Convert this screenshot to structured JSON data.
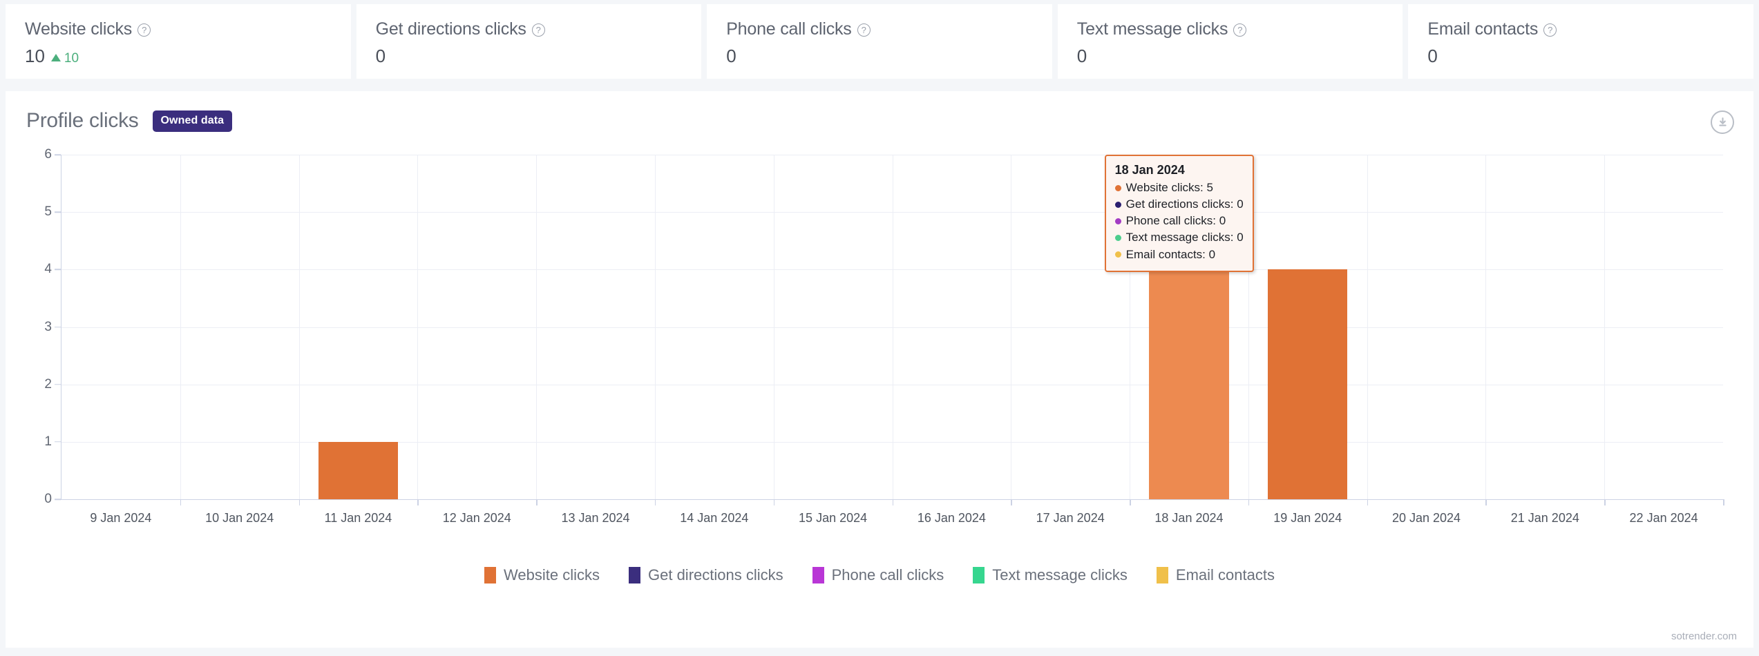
{
  "kpis": [
    {
      "title": "Website clicks",
      "help_icon": "help-circle-icon",
      "value": "10",
      "delta": "10",
      "delta_direction": "up"
    },
    {
      "title": "Get directions clicks",
      "help_icon": "help-circle-icon",
      "value": "0",
      "delta": "",
      "delta_direction": ""
    },
    {
      "title": "Phone call clicks",
      "help_icon": "help-circle-icon",
      "value": "0",
      "delta": "",
      "delta_direction": ""
    },
    {
      "title": "Text message clicks",
      "help_icon": "help-circle-icon",
      "value": "0",
      "delta": "",
      "delta_direction": ""
    },
    {
      "title": "Email contacts",
      "help_icon": "help-circle-icon",
      "value": "0",
      "delta": "",
      "delta_direction": ""
    }
  ],
  "chart_panel": {
    "title": "Profile clicks",
    "badge": "Owned data",
    "badge_color": "#3b2e7e",
    "download_icon": "download-circle-icon"
  },
  "tooltip": {
    "date": "18 Jan 2024",
    "rows": [
      {
        "label": "Website clicks: 5",
        "color": "#e07235"
      },
      {
        "label": "Get directions clicks: 0",
        "color": "#2b2070"
      },
      {
        "label": "Phone call clicks: 0",
        "color": "#a33cc4"
      },
      {
        "label": "Text message clicks: 0",
        "color": "#4ccd8d"
      },
      {
        "label": "Email contacts: 0",
        "color": "#f0c04a"
      }
    ]
  },
  "watermark": "sotrender.com",
  "chart_data": {
    "type": "bar",
    "title": "Profile clicks",
    "xlabel": "",
    "ylabel": "",
    "ylim": [
      0,
      6
    ],
    "yticks": [
      0,
      1,
      2,
      3,
      4,
      5,
      6
    ],
    "grid": true,
    "legend_position": "bottom",
    "categories": [
      "9 Jan 2024",
      "10 Jan 2024",
      "11 Jan 2024",
      "12 Jan 2024",
      "13 Jan 2024",
      "14 Jan 2024",
      "15 Jan 2024",
      "16 Jan 2024",
      "17 Jan 2024",
      "18 Jan 2024",
      "19 Jan 2024",
      "20 Jan 2024",
      "21 Jan 2024",
      "22 Jan 2024"
    ],
    "series": [
      {
        "name": "Website clicks",
        "color": "#e07235",
        "values": [
          0,
          0,
          1,
          0,
          0,
          0,
          0,
          0,
          0,
          5,
          4,
          0,
          0,
          0
        ]
      },
      {
        "name": "Get directions clicks",
        "color": "#3b2e7e",
        "values": [
          0,
          0,
          0,
          0,
          0,
          0,
          0,
          0,
          0,
          0,
          0,
          0,
          0,
          0
        ]
      },
      {
        "name": "Phone call clicks",
        "color": "#b936d6",
        "values": [
          0,
          0,
          0,
          0,
          0,
          0,
          0,
          0,
          0,
          0,
          0,
          0,
          0,
          0
        ]
      },
      {
        "name": "Text message clicks",
        "color": "#36d68f",
        "values": [
          0,
          0,
          0,
          0,
          0,
          0,
          0,
          0,
          0,
          0,
          0,
          0,
          0,
          0
        ]
      },
      {
        "name": "Email contacts",
        "color": "#f0c04a",
        "values": [
          0,
          0,
          0,
          0,
          0,
          0,
          0,
          0,
          0,
          0,
          0,
          0,
          0,
          0
        ]
      }
    ],
    "hovered_category": "18 Jan 2024"
  }
}
